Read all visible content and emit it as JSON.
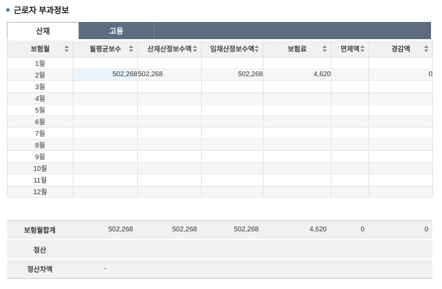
{
  "page": {
    "title": "근로자 부과정보"
  },
  "tabs": [
    {
      "label": "산재",
      "active": true
    },
    {
      "label": "고용",
      "active": false
    }
  ],
  "table": {
    "columns": [
      "보험월",
      "월평균보수",
      "산재산정보수액",
      "임채산정보수액",
      "보험료",
      "면제액",
      "경감액"
    ],
    "sort_icon": "sort-up-down",
    "rows": [
      {
        "month": "1월",
        "values": [
          "",
          "",
          "",
          "",
          "",
          ""
        ],
        "highlight": false
      },
      {
        "month": "2월",
        "values": [
          "502,268",
          "502,268",
          "502,268",
          "4,620",
          "",
          "0"
        ],
        "highlight": true
      },
      {
        "month": "3월",
        "values": [
          "",
          "",
          "",
          "",
          "",
          ""
        ],
        "highlight": false
      },
      {
        "month": "4월",
        "values": [
          "",
          "",
          "",
          "",
          "",
          ""
        ],
        "highlight": false
      },
      {
        "month": "5월",
        "values": [
          "",
          "",
          "",
          "",
          "",
          ""
        ],
        "highlight": false
      },
      {
        "month": "6월",
        "values": [
          "",
          "",
          "",
          "",
          "",
          ""
        ],
        "highlight": false
      },
      {
        "month": "7월",
        "values": [
          "",
          "",
          "",
          "",
          "",
          ""
        ],
        "highlight": false
      },
      {
        "month": "8월",
        "values": [
          "",
          "",
          "",
          "",
          "",
          ""
        ],
        "highlight": false
      },
      {
        "month": "9월",
        "values": [
          "",
          "",
          "",
          "",
          "",
          ""
        ],
        "highlight": false
      },
      {
        "month": "10월",
        "values": [
          "",
          "",
          "",
          "",
          "",
          ""
        ],
        "highlight": false
      },
      {
        "month": "11월",
        "values": [
          "",
          "",
          "",
          "",
          "",
          ""
        ],
        "highlight": false
      },
      {
        "month": "12월",
        "values": [
          "",
          "",
          "",
          "",
          "",
          ""
        ],
        "highlight": false
      }
    ]
  },
  "summary": {
    "rows": [
      {
        "label": "보험월합계",
        "values": [
          "502,268",
          "502,268",
          "502,268",
          "4,620",
          "0",
          "0"
        ]
      },
      {
        "label": "정산",
        "values": [
          "",
          "",
          "",
          "",
          "",
          ""
        ]
      },
      {
        "label": "정산차액",
        "values": [
          "-",
          "",
          "",
          "",
          "",
          ""
        ]
      }
    ]
  },
  "colors": {
    "tab_bar": "#5d6c80",
    "header_bg": "#f1f1f1",
    "stripe_bg": "#f6f6f6",
    "highlight_cell": "#e9f4fb",
    "bullet": "#2e6fb0",
    "summary_bg": "#f1f1f1"
  }
}
